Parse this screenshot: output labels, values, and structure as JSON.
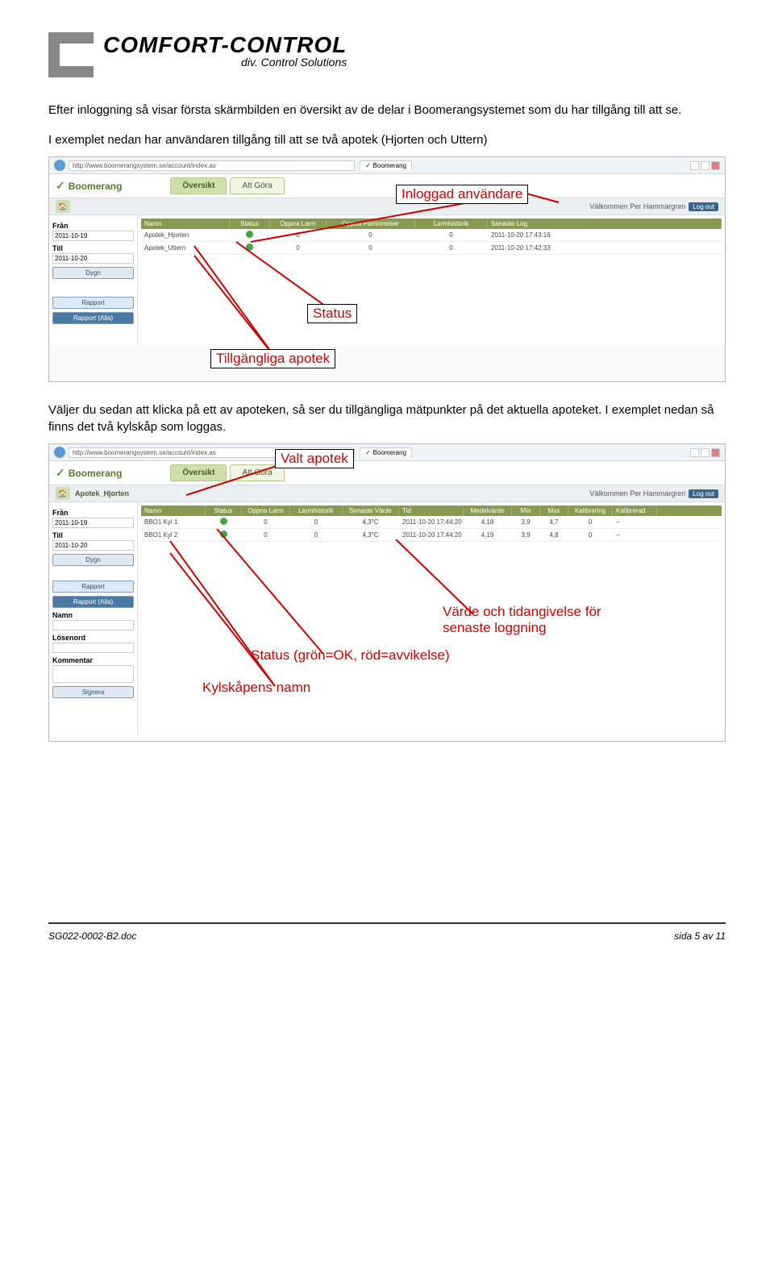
{
  "logo": {
    "main": "COMFORT-CONTROL",
    "sub": "div. Control Solutions"
  },
  "para1": "Efter inloggning så visar första skärmbilden en översikt av de delar i Boomerangsystemet som du har tillgång till att se.",
  "para2": "I exemplet nedan har användaren tillgång till att se två apotek (Hjorten och Uttern)",
  "annotations1": {
    "inloggad": "Inloggad användare",
    "status": "Status",
    "apotek": "Tillgängliga apotek"
  },
  "para3": "Väljer du sedan att klicka på ett av apoteken, så ser du tillgängliga mätpunkter på det aktuella apoteket. I exemplet nedan så finns det två kylskåp som loggas.",
  "annotations2": {
    "valt": "Valt apotek",
    "varde": "Värde och tidangivelse för senaste loggning",
    "status": "Status (grön=OK, röd=avvikelse)",
    "namn": "Kylskåpens namn"
  },
  "browser": {
    "url": "http://www.boomerangsystem.se/account/index.as",
    "tab": "Boomerang"
  },
  "app": {
    "name": "Boomerang",
    "tabs": [
      "Översikt",
      "Att Göra"
    ],
    "welcome": "Välkommen Per Hammargren",
    "logout": "Log out"
  },
  "side": {
    "fran": "Från",
    "franv": "2011-10-19",
    "till": "Till",
    "tillv": "2011-10-20",
    "dygn": "Dygn",
    "rapport": "Rapport",
    "rapportalla": "Rapport (Alla)",
    "namn": "Namn",
    "losen": "Lösenord",
    "komm": "Kommentar",
    "signera": "Signera"
  },
  "grid1": {
    "headers": [
      "Namn",
      "Status",
      "Oppna Larm",
      "Oppna Påminnelser",
      "Larmhistorik",
      "Senaste Log"
    ],
    "rows": [
      {
        "name": "Apotek_Hjorten",
        "ol": "0",
        "op": "0",
        "hist": "0",
        "log": "2011-10-20 17:43:16"
      },
      {
        "name": "Apotek_Uttern",
        "ol": "0",
        "op": "0",
        "hist": "0",
        "log": "2011-10-20 17:42:33"
      }
    ]
  },
  "breadcrumb2": "Apotek_Hjorten",
  "grid2": {
    "headers": [
      "Namn",
      "Status",
      "Oppna Larm",
      "Larmhistorik",
      "Senaste Värde",
      "Tid",
      "Medelvärde",
      "Min",
      "Max",
      "Kalibrering",
      "Kalibrerad"
    ],
    "rows": [
      {
        "name": "BBO1 Kyl 1",
        "ol": "0",
        "lh": "0",
        "sv": "4,3°C",
        "tid": "2011-10-20 17:44:20",
        "mv": "4,18",
        "min": "3,9",
        "max": "4,7",
        "kal": "0",
        "kd": "--"
      },
      {
        "name": "BBO1 Kyl 2",
        "ol": "0",
        "lh": "0",
        "sv": "4,3°C",
        "tid": "2011-10-20 17:44:20",
        "mv": "4,19",
        "min": "3,9",
        "max": "4,8",
        "kal": "0",
        "kd": "--"
      }
    ]
  },
  "footer": {
    "doc": "SG022-0002-B2.doc",
    "page": "sida 5 av 11"
  }
}
